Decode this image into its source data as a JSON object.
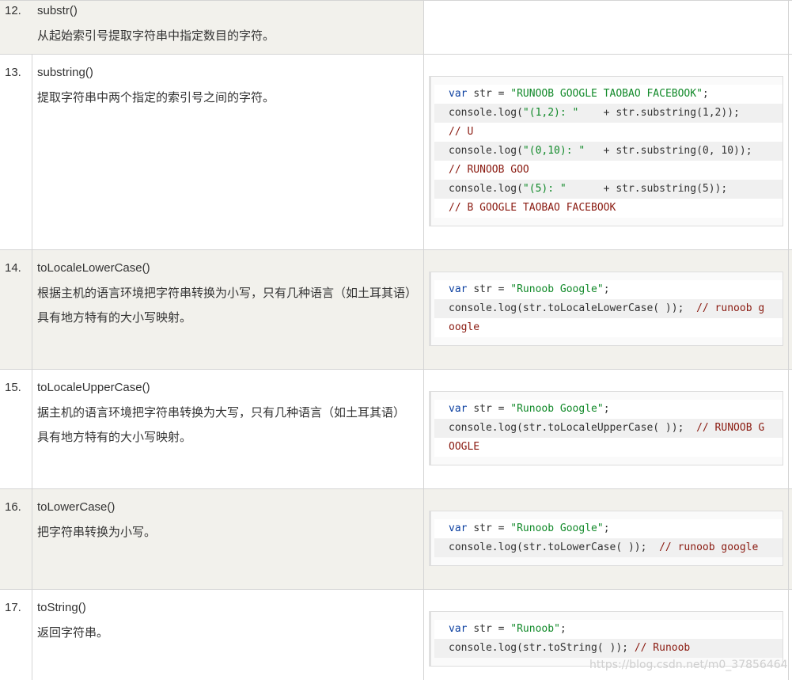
{
  "rows": [
    {
      "num": "12.",
      "name": "substr()",
      "desc": "从起始索引号提取字符串中指定数目的字符。",
      "code": []
    },
    {
      "num": "13.",
      "name": "substring()",
      "desc": "提取字符串中两个指定的索引号之间的字符。",
      "code": [
        [
          [
            "kw",
            "var"
          ],
          [
            "",
            "str = "
          ],
          [
            "str",
            "\"RUNOOB GOOGLE TAOBAO FACEBOOK\""
          ],
          [
            "",
            ";"
          ]
        ],
        [
          [
            "",
            "console.log("
          ],
          [
            "str",
            "\"(1,2): \""
          ],
          [
            "",
            "    + str.substring(1,2));"
          ]
        ],
        [
          [
            "cm",
            "// U"
          ]
        ],
        [
          [
            "",
            "console.log("
          ],
          [
            "str",
            "\"(0,10): \""
          ],
          [
            "",
            "   + str.substring(0, 10));"
          ]
        ],
        [
          [
            "cm",
            "// RUNOOB GOO"
          ]
        ],
        [
          [
            "",
            "console.log("
          ],
          [
            "str",
            "\"(5): \""
          ],
          [
            "",
            "      + str.substring(5));"
          ]
        ],
        [
          [
            "cm",
            "// B GOOGLE TAOBAO FACEBOOK"
          ]
        ]
      ]
    },
    {
      "num": "14.",
      "name": "toLocaleLowerCase()",
      "desc": "根据主机的语言环境把字符串转换为小写，只有几种语言（如土耳其语）具有地方特有的大小写映射。",
      "code": [
        [
          [
            "kw",
            "var"
          ],
          [
            "",
            "str = "
          ],
          [
            "str",
            "\"Runoob Google\""
          ],
          [
            "",
            ";"
          ]
        ],
        [
          [
            "",
            "console.log(str.toLocaleLowerCase( ));  "
          ],
          [
            "cm",
            "// runoob g"
          ]
        ],
        [
          [
            "cm",
            "oogle"
          ]
        ]
      ]
    },
    {
      "num": "15.",
      "name": "toLocaleUpperCase()",
      "desc": "据主机的语言环境把字符串转换为大写，只有几种语言（如土耳其语）具有地方特有的大小写映射。",
      "code": [
        [
          [
            "kw",
            "var"
          ],
          [
            "",
            "str = "
          ],
          [
            "str",
            "\"Runoob Google\""
          ],
          [
            "",
            ";"
          ]
        ],
        [
          [
            "",
            "console.log(str.toLocaleUpperCase( ));  "
          ],
          [
            "cm",
            "// RUNOOB G"
          ]
        ],
        [
          [
            "cm",
            "OOGLE"
          ]
        ]
      ]
    },
    {
      "num": "16.",
      "name": "toLowerCase()",
      "desc": "把字符串转换为小写。",
      "code": [
        [
          [
            "kw",
            "var"
          ],
          [
            "",
            "str = "
          ],
          [
            "str",
            "\"Runoob Google\""
          ],
          [
            "",
            ";"
          ]
        ],
        [
          [
            "",
            "console.log(str.toLowerCase( ));  "
          ],
          [
            "cm",
            "// runoob google"
          ]
        ]
      ]
    },
    {
      "num": "17.",
      "name": "toString()",
      "desc": "返回字符串。",
      "code": [
        [
          [
            "kw",
            "var"
          ],
          [
            "",
            "str = "
          ],
          [
            "str",
            "\"Runoob\""
          ],
          [
            "",
            ";"
          ]
        ],
        [
          [
            "",
            "console.log(str.toString( )); "
          ],
          [
            "cm",
            "// Runoob"
          ]
        ]
      ]
    }
  ],
  "watermark": "https://blog.csdn.net/m0_37856464"
}
